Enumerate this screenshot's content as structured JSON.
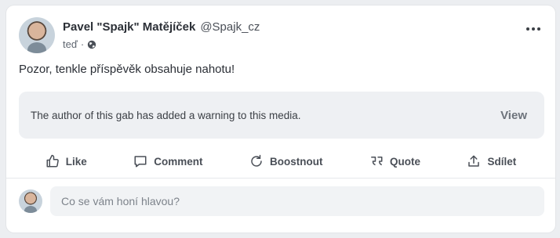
{
  "post": {
    "author": {
      "display_name": "Pavel \"Spajk\" Matějíček",
      "username": "@Spajk_cz",
      "avatar_icon": "user-avatar"
    },
    "time": "teď",
    "separator": "·",
    "visibility_icon": "globe-icon",
    "text": "Pozor, tenkle příspěvěk obsahuje nahotu!",
    "warning": {
      "text": "The author of this gab has added a warning to this media.",
      "view_label": "View"
    },
    "actions": [
      {
        "label": "Like",
        "icon": "thumbs-up-icon"
      },
      {
        "label": "Comment",
        "icon": "comment-icon"
      },
      {
        "label": "Boostnout",
        "icon": "repost-icon"
      },
      {
        "label": "Quote",
        "icon": "quote-icon"
      },
      {
        "label": "Sdílet",
        "icon": "share-icon"
      }
    ],
    "more_icon": "more-horizontal-icon"
  },
  "compose": {
    "placeholder": "Co se vám honí hlavou?"
  },
  "colors": {
    "background": "#eceef1",
    "card": "#ffffff",
    "warning_bg": "#eef0f3",
    "text": "#2b2f36"
  }
}
